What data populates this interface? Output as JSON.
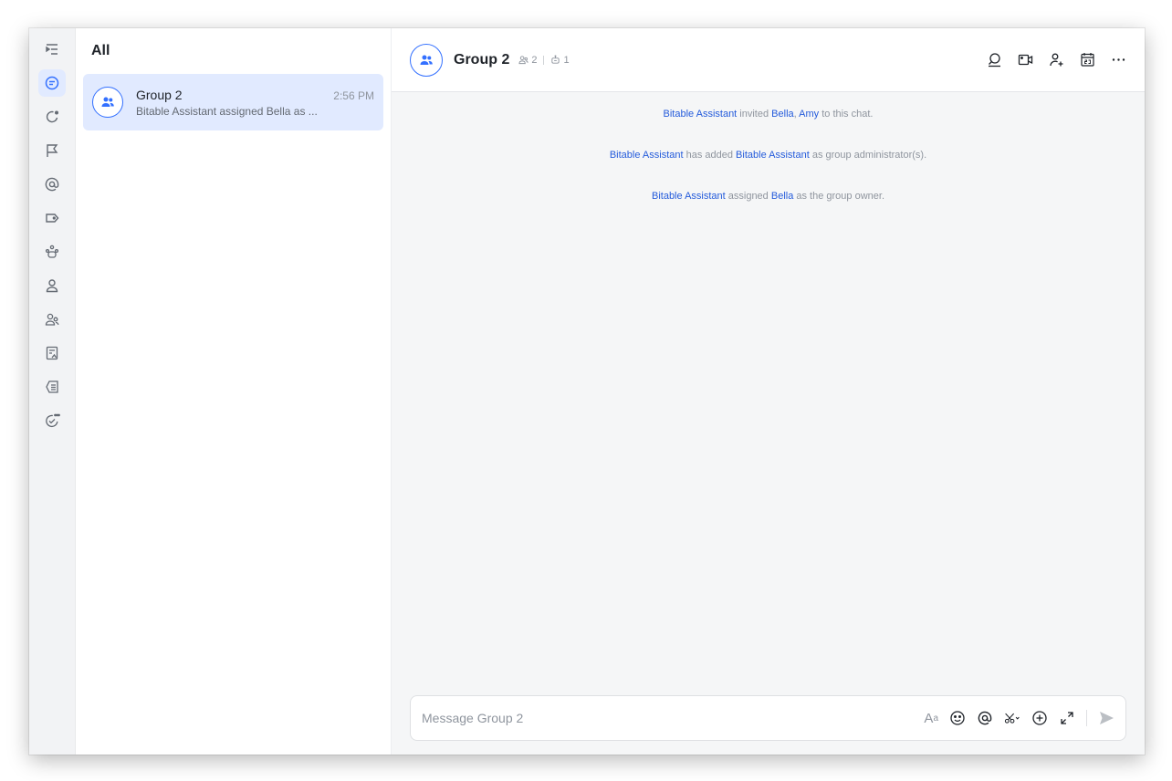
{
  "list": {
    "title": "All",
    "chats": [
      {
        "name": "Group 2",
        "time": "2:56 PM",
        "preview": "Bitable Assistant assigned Bella as ..."
      }
    ]
  },
  "header": {
    "title": "Group 2",
    "member_count": "2",
    "bot_count": "1"
  },
  "messages": [
    {
      "parts": [
        "Bitable Assistant",
        " invited ",
        "Bella",
        ", ",
        "Amy",
        " to this chat."
      ]
    },
    {
      "parts": [
        "Bitable Assistant",
        " has added ",
        "Bitable Assistant",
        " as group administrator(s)."
      ]
    },
    {
      "parts": [
        "Bitable Assistant",
        " assigned ",
        "Bella",
        " as the group owner."
      ]
    }
  ],
  "composer": {
    "placeholder": "Message Group 2",
    "format_label": "A",
    "format_label_small": "a"
  },
  "colors": {
    "accent": "#3370ff",
    "link": "#245bdb",
    "active_bg": "#e1eaff",
    "muted": "#8f959e"
  },
  "rail_icons": [
    "expand-sidebar-icon",
    "messages-icon",
    "updates-icon",
    "flag-icon",
    "mention-icon",
    "tag-icon",
    "bots-icon",
    "contacts-icon",
    "groups-icon",
    "docs-icon",
    "unread-icon",
    "done-icon"
  ],
  "header_icons": [
    "search-icon",
    "video-call-icon",
    "add-member-icon",
    "calendar-icon",
    "more-icon"
  ]
}
